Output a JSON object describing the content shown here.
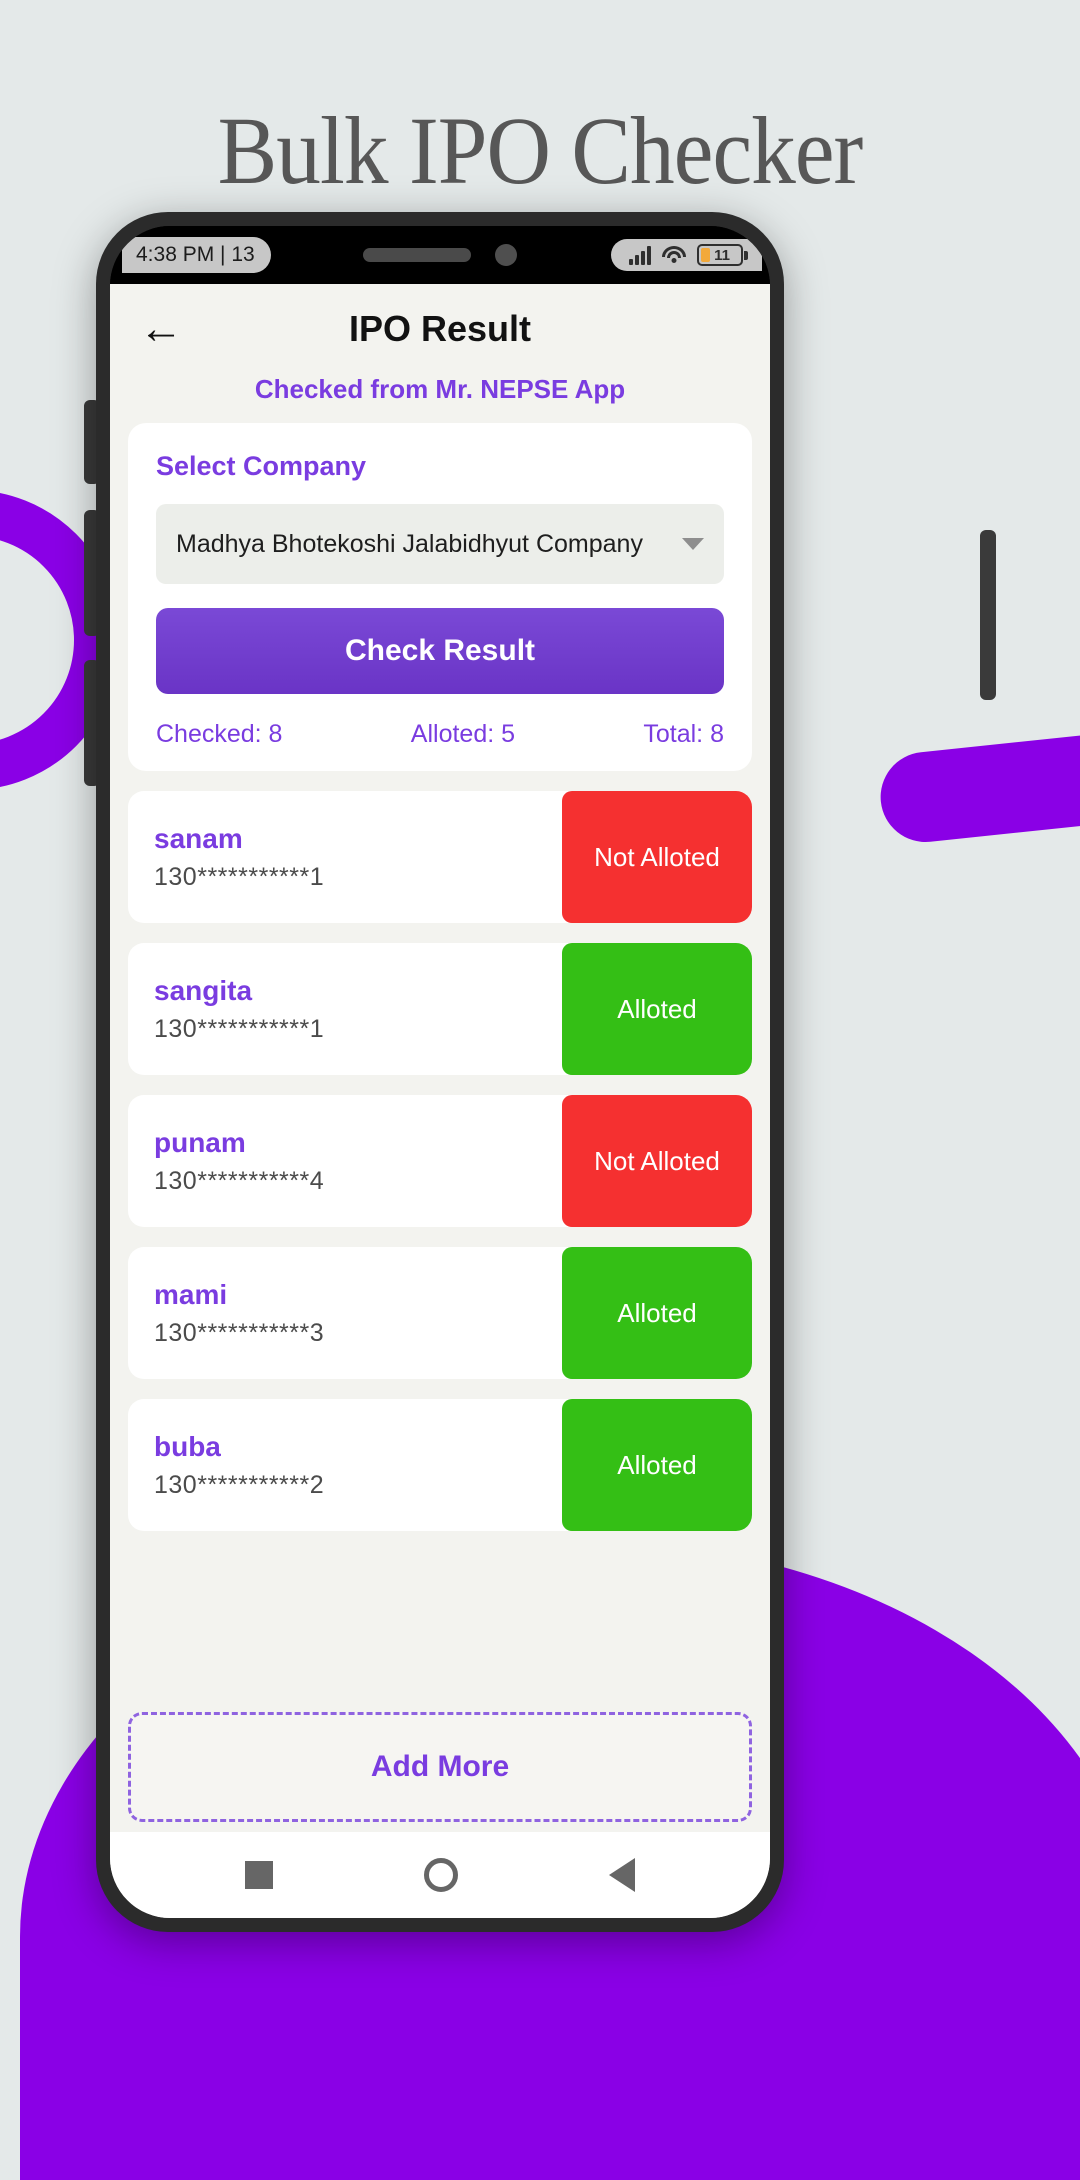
{
  "page": {
    "heading": "Bulk IPO Checker"
  },
  "status_bar": {
    "time": "4:38 PM | 13",
    "battery_level": "11",
    "signal_icon": "signal-bars-icon",
    "wifi_icon": "wifi-icon",
    "battery_icon": "battery-icon"
  },
  "app_bar": {
    "back_icon": "back-arrow-icon",
    "title": "IPO Result"
  },
  "subtitle": "Checked from Mr. NEPSE App",
  "select_card": {
    "label": "Select Company",
    "dropdown_value": "Madhya Bhotekoshi Jalabidhyut Company",
    "dropdown_caret_icon": "chevron-down-icon",
    "check_button": "Check Result",
    "stats": {
      "checked": "Checked: 8",
      "alloted": "Alloted: 5",
      "total": "Total: 8"
    }
  },
  "results": [
    {
      "name": "sanam",
      "number": "130***********1",
      "status": "Not Alloted",
      "allotted": false
    },
    {
      "name": "sangita",
      "number": "130***********1",
      "status": "Alloted",
      "allotted": true
    },
    {
      "name": "punam",
      "number": "130***********4",
      "status": "Not Alloted",
      "allotted": false
    },
    {
      "name": "mami",
      "number": "130***********3",
      "status": "Alloted",
      "allotted": true
    },
    {
      "name": "buba",
      "number": "130***********2",
      "status": "Alloted",
      "allotted": true
    }
  ],
  "add_more": "Add More",
  "nav_bar": {
    "recent_icon": "square-recents-icon",
    "home_icon": "circle-home-icon",
    "back_icon": "triangle-back-icon"
  },
  "colors": {
    "accent_purple": "#7a3ce0",
    "button_purple": "#6a34c6",
    "status_not_alloted": "#f53030",
    "status_alloted": "#34bf15",
    "page_background": "#e4e9e9",
    "blob_purple": "#8a00e6"
  }
}
